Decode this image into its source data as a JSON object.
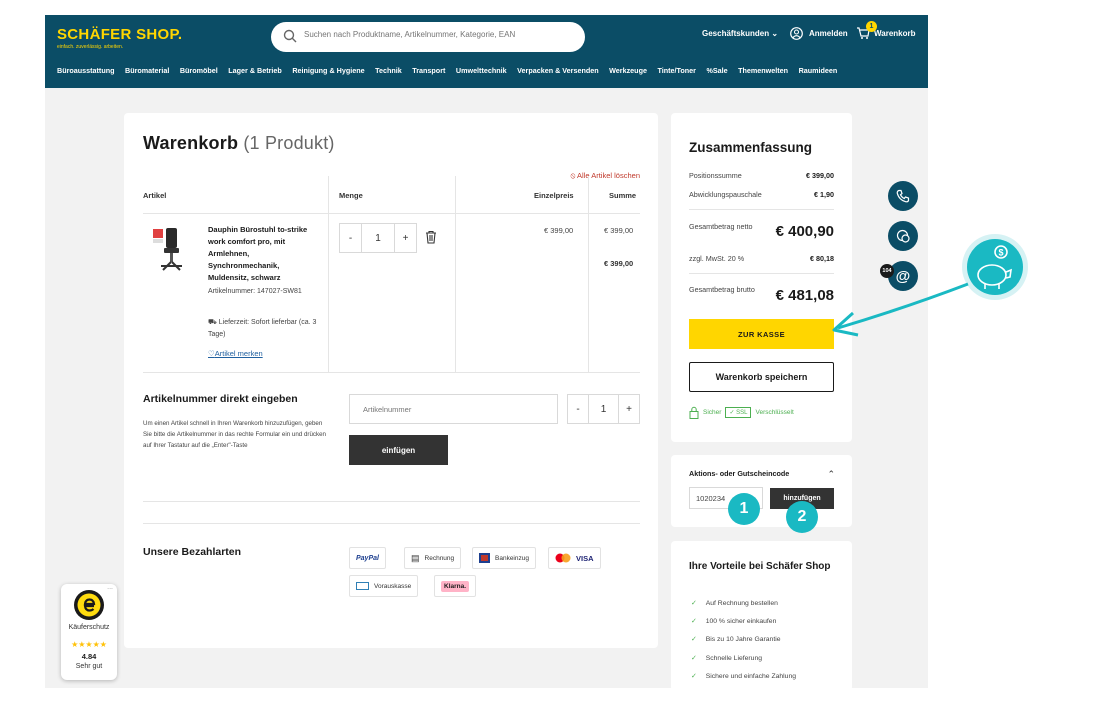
{
  "colors": {
    "header_bg": "#0b4d66",
    "brand_yellow": "#ffd600",
    "accent_teal": "#1ab9c3",
    "delete_red": "#c0392b",
    "secure_green": "#4caf50"
  },
  "header": {
    "logo_main": "SCHÄFER SHOP.",
    "logo_tagline": "einfach. zuverlässig. arbeiten.",
    "search_placeholder": "Suchen nach Produktname, Artikelnummer, Kategorie, EAN",
    "business_label": "Geschäftskunden",
    "login_label": "Anmelden",
    "cart_label": "Warenkorb",
    "cart_count": "1",
    "nav": [
      "Büroausstattung",
      "Büromaterial",
      "Büromöbel",
      "Lager & Betrieb",
      "Reinigung & Hygiene",
      "Technik",
      "Transport",
      "Umwelttechnik",
      "Verpacken & Versenden",
      "Werkzeuge",
      "Tinte/Toner",
      "%Sale",
      "Themenwelten",
      "Raumideen"
    ]
  },
  "cart": {
    "title": "Warenkorb",
    "count": "(1 Produkt)",
    "delete_all": "Alle Artikel löschen",
    "columns": {
      "article": "Artikel",
      "quantity": "Menge",
      "unit_price": "Einzelpreis",
      "sum": "Summe"
    },
    "item": {
      "name": "Dauphin Bürostuhl to-strike work comfort pro, mit Armlehnen, Synchronmechanik, Muldensitz, schwarz",
      "artno": "Artikelnummer: 147027-SW81",
      "delivery": "Lieferzeit: Sofort lieferbar (ca. 3 Tage)",
      "remember": "Artikel merken",
      "qty": "1",
      "minus": "-",
      "plus": "+",
      "unit_price": "€ 399,00",
      "sum": "€ 399,00",
      "sum_total": "€ 399,00"
    }
  },
  "direct": {
    "title": "Artikelnummer direkt eingeben",
    "desc": "Um einen Artikel schnell in Ihren Warenkorb hinzuzufügen, geben Sie bitte die Artikelnummer in das rechte Formular ein und drücken auf Ihrer Tastatur auf die „Enter\"-Taste",
    "placeholder": "Artikelnummer",
    "qty": "1",
    "minus": "-",
    "plus": "+",
    "button": "einfügen"
  },
  "payment": {
    "title": "Unsere Bezahlarten",
    "methods": [
      "PayPal",
      "Rechnung",
      "Bankeinzug",
      "VISA",
      "Vorauskasse",
      "Klarna."
    ]
  },
  "summary": {
    "title": "Zusammenfassung",
    "pos_label": "Positionssumme",
    "pos_value": "€ 399,00",
    "fee_label": "Abwicklungspauschale",
    "fee_value": "€ 1,90",
    "net_label": "Gesamtbetrag netto",
    "net_value": "€ 400,90",
    "vat_label": "zzgl. MwSt. 20 %",
    "vat_value": "€ 80,18",
    "gross_label": "Gesamtbetrag brutto",
    "gross_value": "€ 481,08",
    "checkout": "ZUR KASSE",
    "save": "Warenkorb speichern",
    "secure": "Sicher",
    "ssl": "SSL",
    "encrypted": "Verschlüsselt"
  },
  "coupon": {
    "title": "Aktions- oder Gutscheincode",
    "value": "1020234",
    "button": "hinzufügen"
  },
  "benefits": {
    "title": "Ihre Vorteile bei Schäfer Shop",
    "items": [
      "Auf Rechnung bestellen",
      "100 % sicher einkaufen",
      "Bis zu 10 Jahre Garantie",
      "Schnelle Lieferung",
      "Sichere und einfache Zahlung"
    ]
  },
  "side": {
    "badge": "104"
  },
  "trusted": {
    "label": "Käuferschutz",
    "stars": "★★★★★",
    "score": "4.84",
    "rating": "Sehr gut",
    "dots": "..."
  },
  "callouts": [
    "1",
    "2"
  ]
}
